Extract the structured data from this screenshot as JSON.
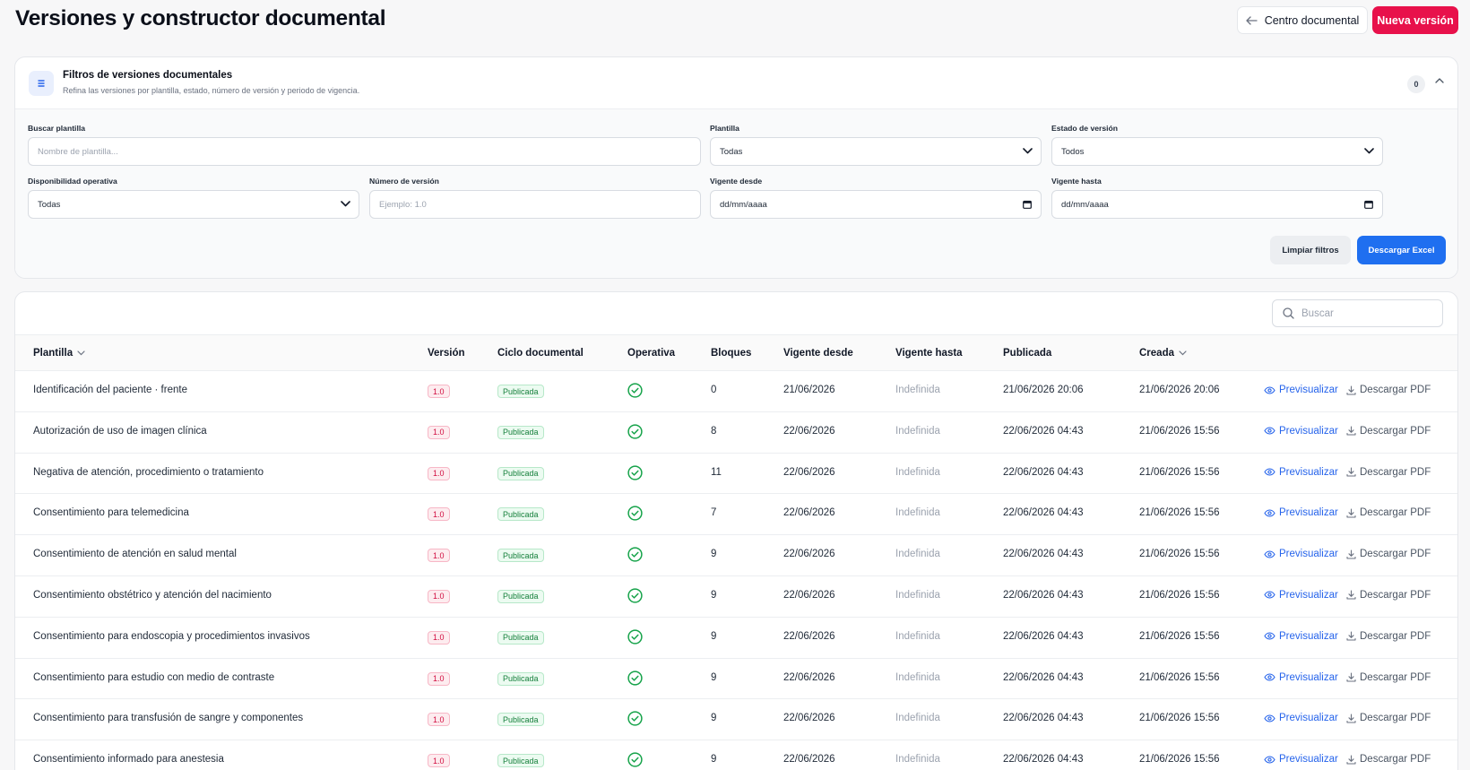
{
  "header": {
    "title": "Versiones y constructor documental",
    "back_label": "Centro documental",
    "new_label": "Nueva versión"
  },
  "filters": {
    "title": "Filtros de versiones documentales",
    "subtitle": "Refina las versiones por plantilla, estado, número de versión y periodo de vigencia.",
    "active_count": "0",
    "search_template": {
      "label": "Buscar plantilla",
      "placeholder": "Nombre de plantilla..."
    },
    "template": {
      "label": "Plantilla",
      "value": "Todas"
    },
    "version_state": {
      "label": "Estado de versión",
      "value": "Todos"
    },
    "availability": {
      "label": "Disponibilidad operativa",
      "value": "Todas"
    },
    "version_number": {
      "label": "Número de versión",
      "placeholder": "Ejemplo: 1.0"
    },
    "valid_from": {
      "label": "Vigente desde",
      "placeholder": "dd/mm/aaaa"
    },
    "valid_to": {
      "label": "Vigente hasta",
      "placeholder": "dd/mm/aaaa"
    },
    "clear_label": "Limpiar filtros",
    "excel_label": "Descargar Excel"
  },
  "table": {
    "search_placeholder": "Buscar",
    "columns": {
      "plantilla": "Plantilla",
      "version": "Versión",
      "ciclo": "Ciclo documental",
      "operativa": "Operativa",
      "bloques": "Bloques",
      "desde": "Vigente desde",
      "hasta": "Vigente hasta",
      "publicada": "Publicada",
      "creada": "Creada"
    },
    "preview_label": "Previsualizar",
    "pdf_label": "Descargar PDF",
    "rows": [
      {
        "plantilla": "Identificación del paciente · frente",
        "version": "1.0",
        "ciclo": "Publicada",
        "bloques": "0",
        "desde": "21/06/2026",
        "hasta": "Indefinida",
        "publicada": "21/06/2026 20:06",
        "creada": "21/06/2026 20:06"
      },
      {
        "plantilla": "Autorización de uso de imagen clínica",
        "version": "1.0",
        "ciclo": "Publicada",
        "bloques": "8",
        "desde": "22/06/2026",
        "hasta": "Indefinida",
        "publicada": "22/06/2026 04:43",
        "creada": "21/06/2026 15:56"
      },
      {
        "plantilla": "Negativa de atención, procedimiento o tratamiento",
        "version": "1.0",
        "ciclo": "Publicada",
        "bloques": "11",
        "desde": "22/06/2026",
        "hasta": "Indefinida",
        "publicada": "22/06/2026 04:43",
        "creada": "21/06/2026 15:56"
      },
      {
        "plantilla": "Consentimiento para telemedicina",
        "version": "1.0",
        "ciclo": "Publicada",
        "bloques": "7",
        "desde": "22/06/2026",
        "hasta": "Indefinida",
        "publicada": "22/06/2026 04:43",
        "creada": "21/06/2026 15:56"
      },
      {
        "plantilla": "Consentimiento de atención en salud mental",
        "version": "1.0",
        "ciclo": "Publicada",
        "bloques": "9",
        "desde": "22/06/2026",
        "hasta": "Indefinida",
        "publicada": "22/06/2026 04:43",
        "creada": "21/06/2026 15:56"
      },
      {
        "plantilla": "Consentimiento obstétrico y atención del nacimiento",
        "version": "1.0",
        "ciclo": "Publicada",
        "bloques": "9",
        "desde": "22/06/2026",
        "hasta": "Indefinida",
        "publicada": "22/06/2026 04:43",
        "creada": "21/06/2026 15:56"
      },
      {
        "plantilla": "Consentimiento para endoscopia y procedimientos invasivos",
        "version": "1.0",
        "ciclo": "Publicada",
        "bloques": "9",
        "desde": "22/06/2026",
        "hasta": "Indefinida",
        "publicada": "22/06/2026 04:43",
        "creada": "21/06/2026 15:56"
      },
      {
        "plantilla": "Consentimiento para estudio con medio de contraste",
        "version": "1.0",
        "ciclo": "Publicada",
        "bloques": "9",
        "desde": "22/06/2026",
        "hasta": "Indefinida",
        "publicada": "22/06/2026 04:43",
        "creada": "21/06/2026 15:56"
      },
      {
        "plantilla": "Consentimiento para transfusión de sangre y componentes",
        "version": "1.0",
        "ciclo": "Publicada",
        "bloques": "9",
        "desde": "22/06/2026",
        "hasta": "Indefinida",
        "publicada": "22/06/2026 04:43",
        "creada": "21/06/2026 15:56"
      },
      {
        "plantilla": "Consentimiento informado para anestesia",
        "version": "1.0",
        "ciclo": "Publicada",
        "bloques": "9",
        "desde": "22/06/2026",
        "hasta": "Indefinida",
        "publicada": "22/06/2026 04:43",
        "creada": "21/06/2026 15:56"
      }
    ]
  },
  "colors": {
    "accent_red": "#e8114b",
    "accent_blue": "#1f6ff0",
    "success_green": "#16a34a"
  }
}
